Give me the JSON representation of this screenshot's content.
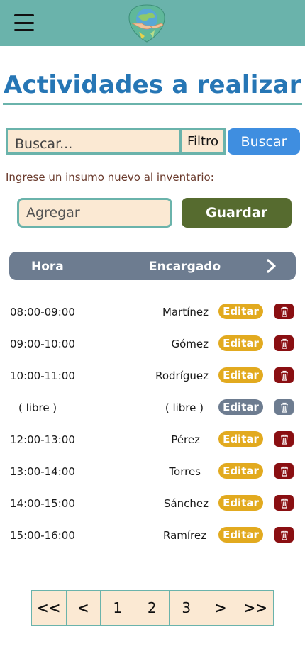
{
  "header": {
    "menu_icon": "hamburger-menu-icon",
    "logo_icon": "hands-globe-logo",
    "color": "#6ab3ab"
  },
  "page": {
    "title": "Actividades a realizar",
    "title_color": "#2676b5"
  },
  "search": {
    "placeholder": "Buscar...",
    "filter_label": "Filtro",
    "button_label": "Buscar"
  },
  "inventory": {
    "label": "Ingrese un insumo nuevo al inventario:",
    "placeholder": "Agregar",
    "save_label": "Guardar"
  },
  "table": {
    "headers": {
      "hora": "Hora",
      "encargado": "Encargado"
    },
    "next_icon": "chevron-right-icon",
    "rows": [
      {
        "hora": "08:00-09:00",
        "encargado": "Martínez",
        "edit": "Editar",
        "disabled": false
      },
      {
        "hora": "09:00-10:00",
        "encargado": "Gómez",
        "edit": "Editar",
        "disabled": false
      },
      {
        "hora": "10:00-11:00",
        "encargado": "Rodríguez",
        "edit": "Editar",
        "disabled": false
      },
      {
        "hora": "( libre )",
        "encargado": "( libre )",
        "edit": "Editar",
        "disabled": true
      },
      {
        "hora": "12:00-13:00",
        "encargado": "Pérez",
        "edit": "Editar",
        "disabled": false
      },
      {
        "hora": "13:00-14:00",
        "encargado": "Torres",
        "edit": "Editar",
        "disabled": false
      },
      {
        "hora": "14:00-15:00",
        "encargado": "Sánchez",
        "edit": "Editar",
        "disabled": false
      },
      {
        "hora": "15:00-16:00",
        "encargado": "Ramírez",
        "edit": "Editar",
        "disabled": false
      }
    ]
  },
  "pagination": {
    "items": [
      "<<",
      "<",
      "1",
      "2",
      "3",
      ">",
      ">>"
    ]
  },
  "colors": {
    "accent": "#6ab3ab",
    "edit": "#e2aa1f",
    "delete": "#8a0f12",
    "disabled": "#6d7c90",
    "input_bg": "#fbe9d3",
    "save": "#566b2f",
    "search": "#3f8ee0"
  }
}
